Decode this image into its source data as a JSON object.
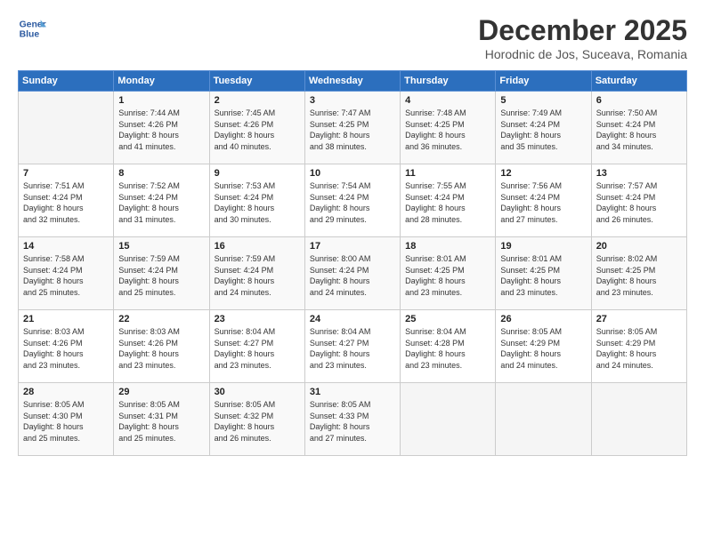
{
  "logo": {
    "line1": "General",
    "line2": "Blue"
  },
  "title": "December 2025",
  "subtitle": "Horodnic de Jos, Suceava, Romania",
  "days_header": [
    "Sunday",
    "Monday",
    "Tuesday",
    "Wednesday",
    "Thursday",
    "Friday",
    "Saturday"
  ],
  "weeks": [
    [
      {
        "day": "",
        "info": ""
      },
      {
        "day": "1",
        "info": "Sunrise: 7:44 AM\nSunset: 4:26 PM\nDaylight: 8 hours\nand 41 minutes."
      },
      {
        "day": "2",
        "info": "Sunrise: 7:45 AM\nSunset: 4:26 PM\nDaylight: 8 hours\nand 40 minutes."
      },
      {
        "day": "3",
        "info": "Sunrise: 7:47 AM\nSunset: 4:25 PM\nDaylight: 8 hours\nand 38 minutes."
      },
      {
        "day": "4",
        "info": "Sunrise: 7:48 AM\nSunset: 4:25 PM\nDaylight: 8 hours\nand 36 minutes."
      },
      {
        "day": "5",
        "info": "Sunrise: 7:49 AM\nSunset: 4:24 PM\nDaylight: 8 hours\nand 35 minutes."
      },
      {
        "day": "6",
        "info": "Sunrise: 7:50 AM\nSunset: 4:24 PM\nDaylight: 8 hours\nand 34 minutes."
      }
    ],
    [
      {
        "day": "7",
        "info": "Sunrise: 7:51 AM\nSunset: 4:24 PM\nDaylight: 8 hours\nand 32 minutes."
      },
      {
        "day": "8",
        "info": "Sunrise: 7:52 AM\nSunset: 4:24 PM\nDaylight: 8 hours\nand 31 minutes."
      },
      {
        "day": "9",
        "info": "Sunrise: 7:53 AM\nSunset: 4:24 PM\nDaylight: 8 hours\nand 30 minutes."
      },
      {
        "day": "10",
        "info": "Sunrise: 7:54 AM\nSunset: 4:24 PM\nDaylight: 8 hours\nand 29 minutes."
      },
      {
        "day": "11",
        "info": "Sunrise: 7:55 AM\nSunset: 4:24 PM\nDaylight: 8 hours\nand 28 minutes."
      },
      {
        "day": "12",
        "info": "Sunrise: 7:56 AM\nSunset: 4:24 PM\nDaylight: 8 hours\nand 27 minutes."
      },
      {
        "day": "13",
        "info": "Sunrise: 7:57 AM\nSunset: 4:24 PM\nDaylight: 8 hours\nand 26 minutes."
      }
    ],
    [
      {
        "day": "14",
        "info": "Sunrise: 7:58 AM\nSunset: 4:24 PM\nDaylight: 8 hours\nand 25 minutes."
      },
      {
        "day": "15",
        "info": "Sunrise: 7:59 AM\nSunset: 4:24 PM\nDaylight: 8 hours\nand 25 minutes."
      },
      {
        "day": "16",
        "info": "Sunrise: 7:59 AM\nSunset: 4:24 PM\nDaylight: 8 hours\nand 24 minutes."
      },
      {
        "day": "17",
        "info": "Sunrise: 8:00 AM\nSunset: 4:24 PM\nDaylight: 8 hours\nand 24 minutes."
      },
      {
        "day": "18",
        "info": "Sunrise: 8:01 AM\nSunset: 4:25 PM\nDaylight: 8 hours\nand 23 minutes."
      },
      {
        "day": "19",
        "info": "Sunrise: 8:01 AM\nSunset: 4:25 PM\nDaylight: 8 hours\nand 23 minutes."
      },
      {
        "day": "20",
        "info": "Sunrise: 8:02 AM\nSunset: 4:25 PM\nDaylight: 8 hours\nand 23 minutes."
      }
    ],
    [
      {
        "day": "21",
        "info": "Sunrise: 8:03 AM\nSunset: 4:26 PM\nDaylight: 8 hours\nand 23 minutes."
      },
      {
        "day": "22",
        "info": "Sunrise: 8:03 AM\nSunset: 4:26 PM\nDaylight: 8 hours\nand 23 minutes."
      },
      {
        "day": "23",
        "info": "Sunrise: 8:04 AM\nSunset: 4:27 PM\nDaylight: 8 hours\nand 23 minutes."
      },
      {
        "day": "24",
        "info": "Sunrise: 8:04 AM\nSunset: 4:27 PM\nDaylight: 8 hours\nand 23 minutes."
      },
      {
        "day": "25",
        "info": "Sunrise: 8:04 AM\nSunset: 4:28 PM\nDaylight: 8 hours\nand 23 minutes."
      },
      {
        "day": "26",
        "info": "Sunrise: 8:05 AM\nSunset: 4:29 PM\nDaylight: 8 hours\nand 24 minutes."
      },
      {
        "day": "27",
        "info": "Sunrise: 8:05 AM\nSunset: 4:29 PM\nDaylight: 8 hours\nand 24 minutes."
      }
    ],
    [
      {
        "day": "28",
        "info": "Sunrise: 8:05 AM\nSunset: 4:30 PM\nDaylight: 8 hours\nand 25 minutes."
      },
      {
        "day": "29",
        "info": "Sunrise: 8:05 AM\nSunset: 4:31 PM\nDaylight: 8 hours\nand 25 minutes."
      },
      {
        "day": "30",
        "info": "Sunrise: 8:05 AM\nSunset: 4:32 PM\nDaylight: 8 hours\nand 26 minutes."
      },
      {
        "day": "31",
        "info": "Sunrise: 8:05 AM\nSunset: 4:33 PM\nDaylight: 8 hours\nand 27 minutes."
      },
      {
        "day": "",
        "info": ""
      },
      {
        "day": "",
        "info": ""
      },
      {
        "day": "",
        "info": ""
      }
    ]
  ]
}
